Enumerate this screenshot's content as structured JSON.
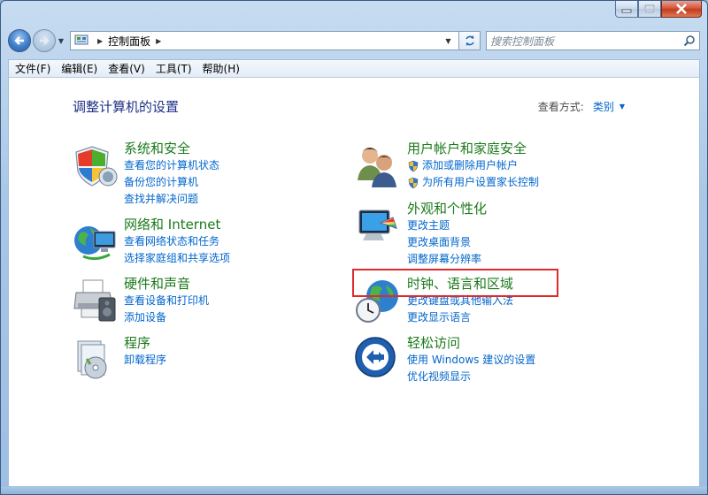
{
  "window": {
    "caption": {
      "min": "minimize-icon",
      "max": "maximize-icon",
      "close": "close-icon"
    }
  },
  "address": {
    "location": "控制面板",
    "search_placeholder": "搜索控制面板"
  },
  "menu": [
    "文件(F)",
    "编辑(E)",
    "查看(V)",
    "工具(T)",
    "帮助(H)"
  ],
  "page": {
    "title": "调整计算机的设置",
    "view_by_label": "查看方式:",
    "view_by_value": "类别"
  },
  "categories": [
    {
      "title": "系统和安全",
      "icon": "shield-security-icon",
      "links": [
        "查看您的计算机状态",
        "备份您的计算机",
        "查找并解决问题"
      ]
    },
    {
      "title": "网络和 Internet",
      "icon": "network-globe-icon",
      "links": [
        "查看网络状态和任务",
        "选择家庭组和共享选项"
      ]
    },
    {
      "title": "硬件和声音",
      "icon": "printer-hardware-icon",
      "links": [
        "查看设备和打印机",
        "添加设备"
      ]
    },
    {
      "title": "程序",
      "icon": "programs-disc-icon",
      "links": [
        "卸载程序"
      ]
    },
    {
      "title": "用户帐户和家庭安全",
      "icon": "users-icon",
      "links": [
        "添加或删除用户帐户",
        "为所有用户设置家长控制"
      ]
    },
    {
      "title": "外观和个性化",
      "icon": "monitor-palette-icon",
      "links": [
        "更改主题",
        "更改桌面背景",
        "调整屏幕分辨率"
      ]
    },
    {
      "title": "时钟、语言和区域",
      "icon": "globe-clock-icon",
      "links": [
        "更改键盘或其他输入法",
        "更改显示语言"
      ]
    },
    {
      "title": "轻松访问",
      "icon": "ease-of-access-icon",
      "links": [
        "使用 Windows 建议的设置",
        "优化视频显示"
      ]
    }
  ],
  "colors": {
    "category_title": "#1b7a1b",
    "link": "#0066cc",
    "page_title": "#1e3287",
    "highlight": "#e0292b"
  }
}
